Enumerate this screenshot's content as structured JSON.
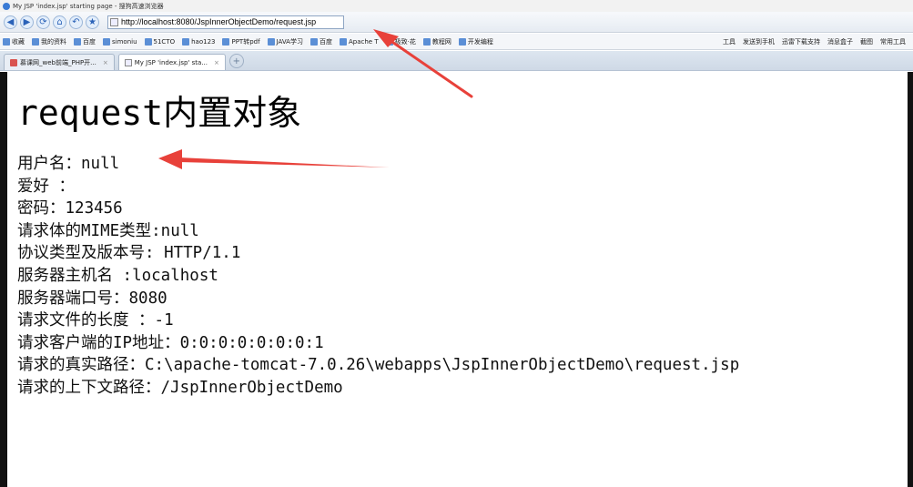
{
  "window": {
    "title": "My JSP 'index.jsp' starting page - 搜狗高速浏览器"
  },
  "nav": {
    "back_glyph": "◀",
    "forward_glyph": "▶",
    "refresh_glyph": "⟳",
    "home_glyph": "⌂",
    "undo_glyph": "↶",
    "favorite_glyph": "★",
    "url": "http://localhost:8080/JspInnerObjectDemo/request.jsp"
  },
  "bookmarks": {
    "left": [
      "收藏",
      "我的资料",
      "百度",
      "simoniu",
      "51CTO",
      "hao123",
      "PPT转pdf",
      "JAVA学习",
      "百度",
      "Apache T",
      "极致·花",
      "教程网",
      "开发编程"
    ],
    "right": [
      "工具",
      "发送到手机",
      "迅雷下载支持",
      "消息盒子",
      "截图",
      "常用工具"
    ]
  },
  "tabs": [
    {
      "label": "慕课网_web前端_PHP开...",
      "active": false,
      "close": "×"
    },
    {
      "label": "My JSP 'index.jsp' sta...",
      "active": true,
      "close": "×"
    }
  ],
  "newtab_glyph": "+",
  "page": {
    "heading": "request内置对象",
    "lines": [
      "用户名：null",
      "爱好 ：",
      "密码：123456",
      "请求体的MIME类型:null",
      "协议类型及版本号: HTTP/1.1",
      "服务器主机名 :localhost",
      "服务器端口号：8080",
      "请求文件的长度 ：-1",
      "请求客户端的IP地址：0:0:0:0:0:0:0:1",
      "请求的真实路径：C:\\apache-tomcat-7.0.26\\webapps\\JspInnerObjectDemo\\request.jsp",
      "请求的上下文路径：/JspInnerObjectDemo"
    ]
  },
  "colors": {
    "annotation_arrow": "#e8413a",
    "tab_icon": "#d9534f"
  }
}
